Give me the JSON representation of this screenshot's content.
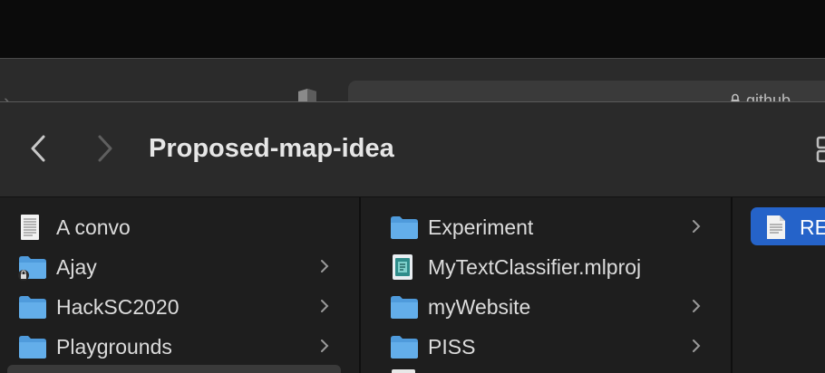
{
  "background_window": {
    "url_fragment": "github."
  },
  "finder": {
    "title": "Proposed-map-idea",
    "column_1": [
      {
        "name": "A convo",
        "type": "document",
        "has_children": false
      },
      {
        "name": "Ajay",
        "type": "locked-folder",
        "has_children": true
      },
      {
        "name": "HackSC2020",
        "type": "folder",
        "has_children": true
      },
      {
        "name": "Playgrounds",
        "type": "folder",
        "has_children": true
      }
    ],
    "column_2": [
      {
        "name": "Experiment",
        "type": "folder",
        "has_children": true
      },
      {
        "name": "MyTextClassifier.mlproj",
        "type": "mlproj",
        "has_children": false
      },
      {
        "name": "myWebsite",
        "type": "folder",
        "has_children": true
      },
      {
        "name": "PISS",
        "type": "folder",
        "has_children": true
      }
    ],
    "column_3": {
      "selected_label": "RE"
    }
  },
  "colors": {
    "folder_blue": "#5aa8e6",
    "selection": "#2563c9"
  }
}
